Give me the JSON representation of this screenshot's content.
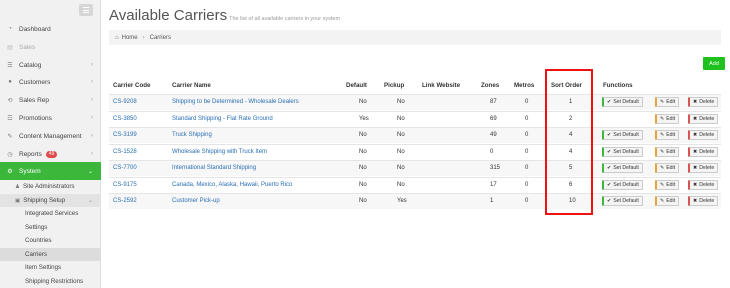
{
  "sidebar": {
    "items": [
      {
        "label": "Dashboard",
        "icon": "dashboard-icon",
        "glyph": "◔",
        "chev": ""
      },
      {
        "label": "Sales",
        "icon": "sales-icon",
        "glyph": "▤",
        "chev": "",
        "disabled": true
      },
      {
        "label": "Catalog",
        "icon": "catalog-icon",
        "glyph": "☰",
        "chev": "‹"
      },
      {
        "label": "Customers",
        "icon": "customers-icon",
        "glyph": "●",
        "chev": "‹"
      },
      {
        "label": "Sales Rep",
        "icon": "sales-rep-icon",
        "glyph": "⟲",
        "chev": "‹"
      },
      {
        "label": "Promotions",
        "icon": "promotions-icon",
        "glyph": "☲",
        "chev": "‹"
      },
      {
        "label": "Content Management",
        "icon": "content-icon",
        "glyph": "✎",
        "chev": "‹"
      },
      {
        "label": "Reports",
        "icon": "reports-icon",
        "glyph": "◷",
        "chev": "‹",
        "badge": "49"
      },
      {
        "label": "System",
        "icon": "system-icon",
        "glyph": "⚙",
        "chev": "⌄",
        "active": true
      }
    ],
    "system_children": [
      {
        "label": "Site Administrators",
        "icon": "admin-icon",
        "glyph": "♟"
      },
      {
        "label": "Shipping Setup",
        "icon": "shipping-icon",
        "glyph": "▣",
        "chev": "⌄"
      }
    ],
    "shipping_children": [
      "Integrated Services",
      "Settings",
      "Countries",
      "Carriers",
      "Item Settings",
      "Shipping Restrictions"
    ]
  },
  "header": {
    "title": "Available Carriers",
    "subtitle": "The list of all available carriers in your system"
  },
  "breadcrumb": {
    "home": "Home",
    "current": "Carriers"
  },
  "add_label": "Add",
  "table": {
    "columns": [
      "Carrier Code",
      "Carrier Name",
      "Default",
      "Pickup",
      "Link Website",
      "Zones",
      "Metros",
      "Sort Order",
      "Functions"
    ],
    "buttons": {
      "set_default": "Set Default",
      "edit": "Edit",
      "delete": "Delete"
    },
    "rows": [
      {
        "code": "CS-9208",
        "name": "Shipping to be Determined - Wholesale Dealers",
        "default": "No",
        "pickup": "No",
        "zones": "87",
        "metros": "0",
        "sort": "1",
        "set_default": true
      },
      {
        "code": "CS-3850",
        "name": "Standard Shipping - Flat Rate Ground",
        "default": "Yes",
        "pickup": "No",
        "zones": "69",
        "metros": "0",
        "sort": "2",
        "set_default": false
      },
      {
        "code": "CS-3199",
        "name": "Truck Shipping",
        "default": "No",
        "pickup": "No",
        "zones": "49",
        "metros": "0",
        "sort": "4",
        "set_default": true
      },
      {
        "code": "CS-1528",
        "name": "Wholesale Shipping with Truck Item",
        "default": "No",
        "pickup": "No",
        "zones": "0",
        "metros": "0",
        "sort": "4",
        "set_default": true
      },
      {
        "code": "CS-7700",
        "name": "International Standard Shipping",
        "default": "No",
        "pickup": "No",
        "zones": "315",
        "metros": "0",
        "sort": "5",
        "set_default": true
      },
      {
        "code": "CS-9175",
        "name": "Canada, Mexico, Alaska, Hawaii, Puerto Rico",
        "default": "No",
        "pickup": "No",
        "zones": "17",
        "metros": "0",
        "sort": "6",
        "set_default": true
      },
      {
        "code": "CS-2592",
        "name": "Customer Pick-up",
        "default": "No",
        "pickup": "Yes",
        "zones": "1",
        "metros": "0",
        "sort": "10",
        "set_default": true
      }
    ]
  },
  "colors": {
    "accent": "#3cb73c",
    "add": "#1ec11e",
    "link": "#2a6fb5",
    "highlight": "#ee1111"
  }
}
